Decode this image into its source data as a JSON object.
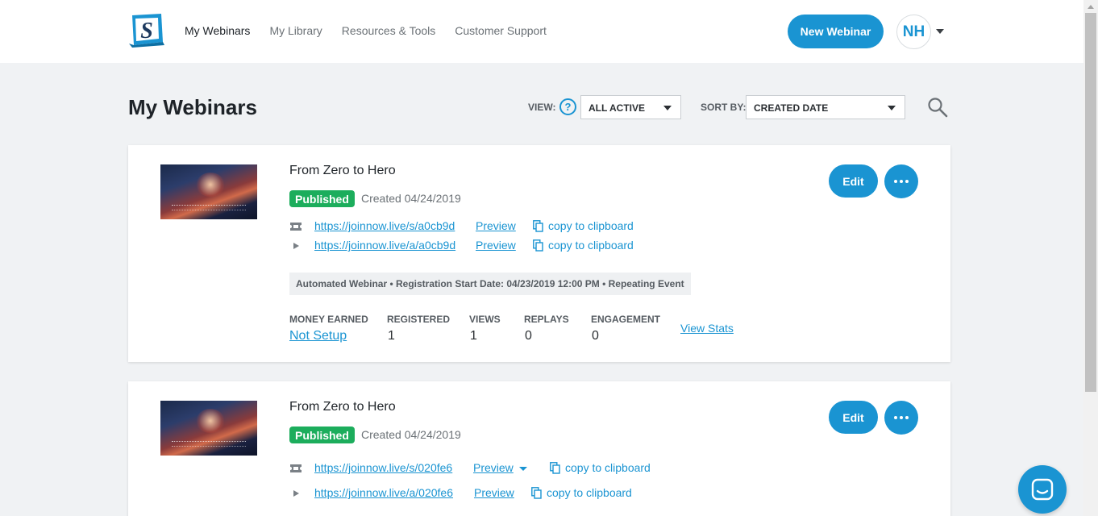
{
  "header": {
    "logo_letter": "S",
    "nav": [
      {
        "label": "My Webinars",
        "active": true
      },
      {
        "label": "My Library",
        "active": false
      },
      {
        "label": "Resources & Tools",
        "active": false
      },
      {
        "label": "Customer Support",
        "active": false
      }
    ],
    "new_webinar_label": "New Webinar",
    "avatar_initials": "NH"
  },
  "toolbar": {
    "page_title": "My Webinars",
    "view_label": "VIEW:",
    "view_value": "ALL ACTIVE",
    "sort_label": "SORT BY:",
    "sort_value": "CREATED DATE",
    "help_glyph": "?"
  },
  "webinars": [
    {
      "title": "From Zero to Hero",
      "status": "Published",
      "created": "Created 04/24/2019",
      "links": [
        {
          "icon": "ticket-icon",
          "url": "https://joinnow.live/s/a0cb9d",
          "preview": "Preview",
          "copy": "copy to clipboard"
        },
        {
          "icon": "play-icon",
          "url": "https://joinnow.live/a/a0cb9d",
          "preview": "Preview",
          "copy": "copy to clipboard"
        }
      ],
      "info": "Automated Webinar • Registration Start Date: 04/23/2019 12:00 PM • Repeating Event",
      "stats": [
        {
          "label": "MONEY EARNED",
          "value": "Not Setup"
        },
        {
          "label": "REGISTERED",
          "value": "1"
        },
        {
          "label": "VIEWS",
          "value": "1"
        },
        {
          "label": "REPLAYS",
          "value": "0"
        },
        {
          "label": "ENGAGEMENT",
          "value": "0"
        }
      ],
      "view_stats": "View Stats",
      "edit_label": "Edit"
    },
    {
      "title": "From Zero to Hero",
      "status": "Published",
      "created": "Created 04/24/2019",
      "links": [
        {
          "icon": "ticket-icon",
          "url": "https://joinnow.live/s/020fe6",
          "preview": "Preview",
          "copy": "copy to clipboard"
        },
        {
          "icon": "play-icon",
          "url": "https://joinnow.live/a/020fe6",
          "preview": "Preview",
          "copy": "copy to clipboard"
        }
      ],
      "edit_label": "Edit"
    }
  ],
  "colors": {
    "accent": "#1a94d2",
    "published": "#1cad5c",
    "background": "#f0f2f4"
  }
}
